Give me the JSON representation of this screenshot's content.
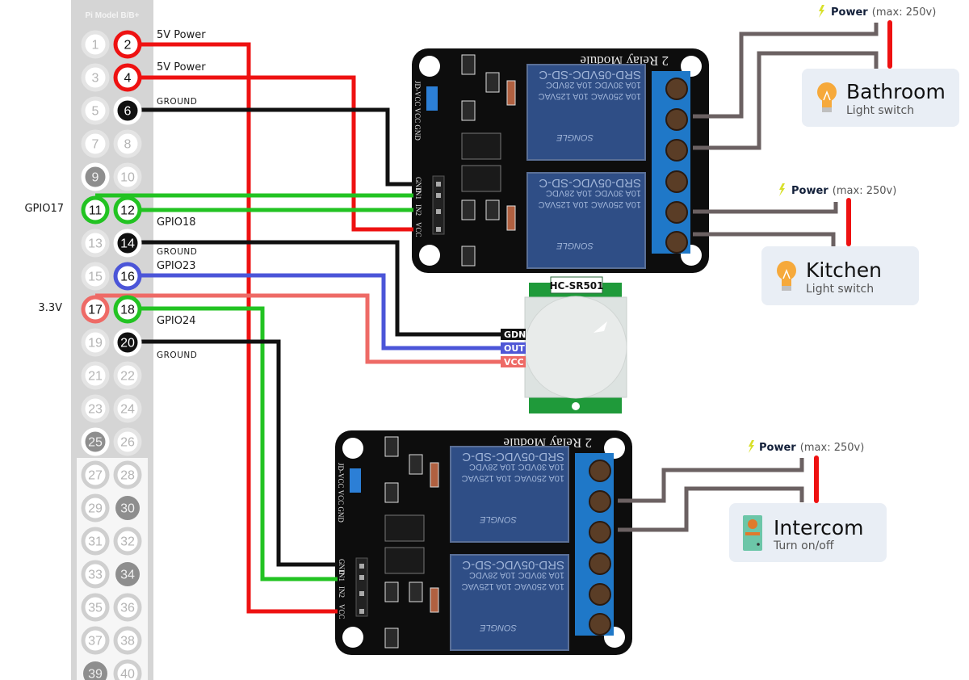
{
  "header": {
    "title": "Pi Model B/B+",
    "pins": [
      {
        "n": "1",
        "kind": "plain"
      },
      {
        "n": "2",
        "kind": "power5v"
      },
      {
        "n": "3",
        "kind": "plain"
      },
      {
        "n": "4",
        "kind": "power5v"
      },
      {
        "n": "5",
        "kind": "plain"
      },
      {
        "n": "6",
        "kind": "ground"
      },
      {
        "n": "7",
        "kind": "plain"
      },
      {
        "n": "8",
        "kind": "plain"
      },
      {
        "n": "9",
        "kind": "dark-ring"
      },
      {
        "n": "10",
        "kind": "plain"
      },
      {
        "n": "11",
        "kind": "gpio-green"
      },
      {
        "n": "12",
        "kind": "gpio-green"
      },
      {
        "n": "13",
        "kind": "plain"
      },
      {
        "n": "14",
        "kind": "ground"
      },
      {
        "n": "15",
        "kind": "plain"
      },
      {
        "n": "16",
        "kind": "gpio-blue"
      },
      {
        "n": "17",
        "kind": "power3v3"
      },
      {
        "n": "18",
        "kind": "gpio-green"
      },
      {
        "n": "19",
        "kind": "plain"
      },
      {
        "n": "20",
        "kind": "ground"
      },
      {
        "n": "21",
        "kind": "plain"
      },
      {
        "n": "22",
        "kind": "plain"
      },
      {
        "n": "23",
        "kind": "plain"
      },
      {
        "n": "24",
        "kind": "plain"
      },
      {
        "n": "25",
        "kind": "dark-ring"
      },
      {
        "n": "26",
        "kind": "plain"
      },
      {
        "n": "27",
        "kind": "ring"
      },
      {
        "n": "28",
        "kind": "ring"
      },
      {
        "n": "29",
        "kind": "ring"
      },
      {
        "n": "30",
        "kind": "dark"
      },
      {
        "n": "31",
        "kind": "ring"
      },
      {
        "n": "32",
        "kind": "ring"
      },
      {
        "n": "33",
        "kind": "ring"
      },
      {
        "n": "34",
        "kind": "dark"
      },
      {
        "n": "35",
        "kind": "ring"
      },
      {
        "n": "36",
        "kind": "ring"
      },
      {
        "n": "37",
        "kind": "ring"
      },
      {
        "n": "38",
        "kind": "ring"
      },
      {
        "n": "39",
        "kind": "dark"
      },
      {
        "n": "40",
        "kind": "ring"
      }
    ]
  },
  "pin_labels": {
    "pin2": "5V Power",
    "pin4": "5V Power",
    "pin6": "GROUND",
    "pin11": "GPIO17",
    "pin12": "GPIO18",
    "pin14": "GROUND",
    "pin16": "GPIO23",
    "pin17": "3.3V",
    "pin18": "GPIO24",
    "pin20": "GROUND"
  },
  "relay_module": {
    "title": "2 Relay Module",
    "relay_model": "SRD-05VDC-SD-C",
    "relay_rating1": "10A 250VAC  10A 125VAC",
    "relay_rating2": "10A 30VDC  10A 28VDC",
    "relay_brand": "SONGLE",
    "header_pins": [
      "GND",
      "IN1",
      "IN2",
      "VCC"
    ],
    "jumper_label": "JD-VCC VCC GND"
  },
  "sensor": {
    "name": "HC-SR501",
    "pins": [
      {
        "label": "GDN",
        "color": "#111111"
      },
      {
        "label": "OUT",
        "color": "#5057d6"
      },
      {
        "label": "VCC",
        "color": "#ee6a66"
      }
    ]
  },
  "loads": [
    {
      "title": "Bathroom",
      "subtitle": "Light switch",
      "icon": "light-bulb-icon",
      "power_bold": "Power",
      "power_note": "(max: 250v)"
    },
    {
      "title": "Kitchen",
      "subtitle": "Light switch",
      "icon": "light-bulb-icon",
      "power_bold": "Power",
      "power_note": "(max: 250v)"
    },
    {
      "title": "Intercom",
      "subtitle": "Turn on/off",
      "icon": "intercom-icon",
      "power_bold": "Power",
      "power_note": "(max: 250v)"
    }
  ],
  "colors": {
    "power_5v": "#ee1111",
    "power_3v3": "#ee6a66",
    "ground": "#111111",
    "gpio_green": "#22c322",
    "gpio_blue": "#4b55d8",
    "mains": "#6b6162",
    "mains_live": "#ee1111",
    "header_bg": "#d5d5d5",
    "card_bg": "#e9eef5"
  }
}
